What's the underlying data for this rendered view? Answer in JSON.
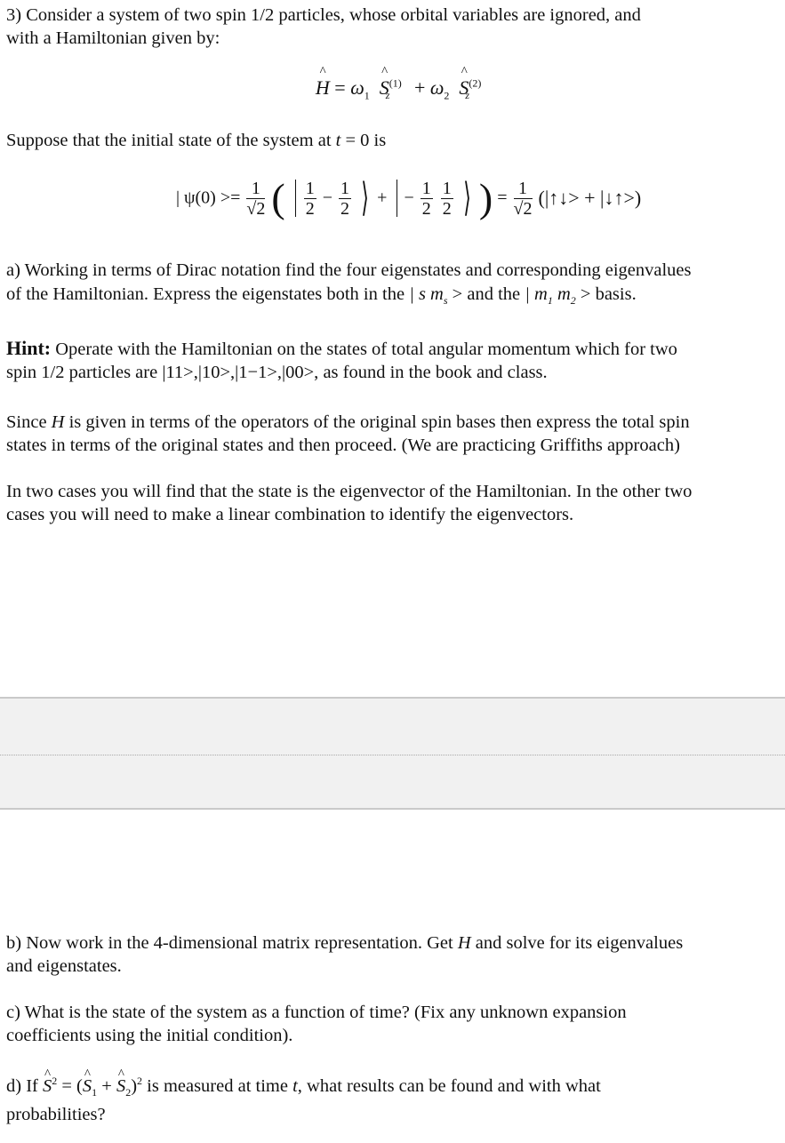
{
  "problem": {
    "intro_line1": "3) Consider a system of two spin 1/2 particles,  whose orbital variables are ignored, and",
    "intro_line2": "with a Hamiltonian given by:",
    "hamiltonian": {
      "H": "H",
      "eq": "=",
      "w1": "ω",
      "w1_sub": "1",
      "S1": "S",
      "S1_sub": "z",
      "S1_sup": "(1)",
      "plus": "+",
      "w2": "ω",
      "w2_sub": "2",
      "S2": "S",
      "S2_sub": "z",
      "S2_sup": "(2)"
    },
    "initial_text_a": "Suppose that the initial state of the system at ",
    "initial_t": "t",
    "initial_eq": " = 0",
    "initial_text_b": " is",
    "psi0": {
      "lhs": "| ψ(0) >=",
      "coef_num": "1",
      "coef_den": "√2",
      "ket1_a_num": "1",
      "ket1_a_den": "2",
      "ket1_minus": "−",
      "ket1_b_num": "1",
      "ket1_b_den": "2",
      "plus": "+",
      "ket2_minus": "−",
      "ket2_a_num": "1",
      "ket2_a_den": "2",
      "ket2_b_num": "1",
      "ket2_b_den": "2",
      "equals": "=",
      "coef2_num": "1",
      "coef2_den": "√2",
      "rhs": "(|↑↓> + |↓↑>)"
    }
  },
  "part_a": {
    "line1": "a) Working in terms of Dirac notation find the four eigenstates and corresponding eigenvalues",
    "line2_a": "of the Hamiltonian. Express the eigenstates both in the ",
    "basis1": "| s m",
    "basis1_sub": "s",
    "basis1_end": " >",
    "line2_b": " and the ",
    "basis2_a": "| m",
    "basis2_sub1": "1",
    "basis2_b": " m",
    "basis2_sub2": "2",
    "basis2_end": " >",
    "line2_c": " basis."
  },
  "hint": {
    "label": "Hint:",
    "line1": " Operate with the Hamiltonian on the states of total angular  momentum which for two",
    "line2_a": "spin 1/2 particles are ",
    "states": "|11>,|10>,|1−1>,|00>,",
    "line2_b": "  as found in the book and class."
  },
  "note1": {
    "line1_a": "Since ",
    "H": "H",
    "line1_b": "  is given in terms of the operators of the original spin bases then express the total spin",
    "line2": "states in terms of the original states and then proceed. (We are practicing Griffiths approach)"
  },
  "note2": {
    "line1": "In two cases you will find that the state is the eigenvector of the Hamiltonian.  In the other two",
    "line2": "cases you will need to make a linear combination to identify  the eigenvectors."
  },
  "part_b": {
    "line1_a": "b) Now work in the 4-dimensional matrix representation. Get ",
    "H": "H",
    "line1_b": "  and solve for its eigenvalues",
    "line2": "and eigenstates."
  },
  "part_c": {
    "line1": "c) What is the state of the system as a function of time?  (Fix any unknown expansion",
    "line2": "coefficients using the initial condition)."
  },
  "part_d": {
    "line1_a": "d) If ",
    "S": "S",
    "S_sup": "2",
    "eq": " = (",
    "S1": "S",
    "S1_sub": "1",
    "plus": " + ",
    "S2": "S",
    "S2_sub": "2",
    "close": ")",
    "close_sup": "2",
    "line1_b": "  is measured at time ",
    "t": "t",
    "line1_c": ", what results can be found  and with what",
    "line2": "probabilities?"
  }
}
